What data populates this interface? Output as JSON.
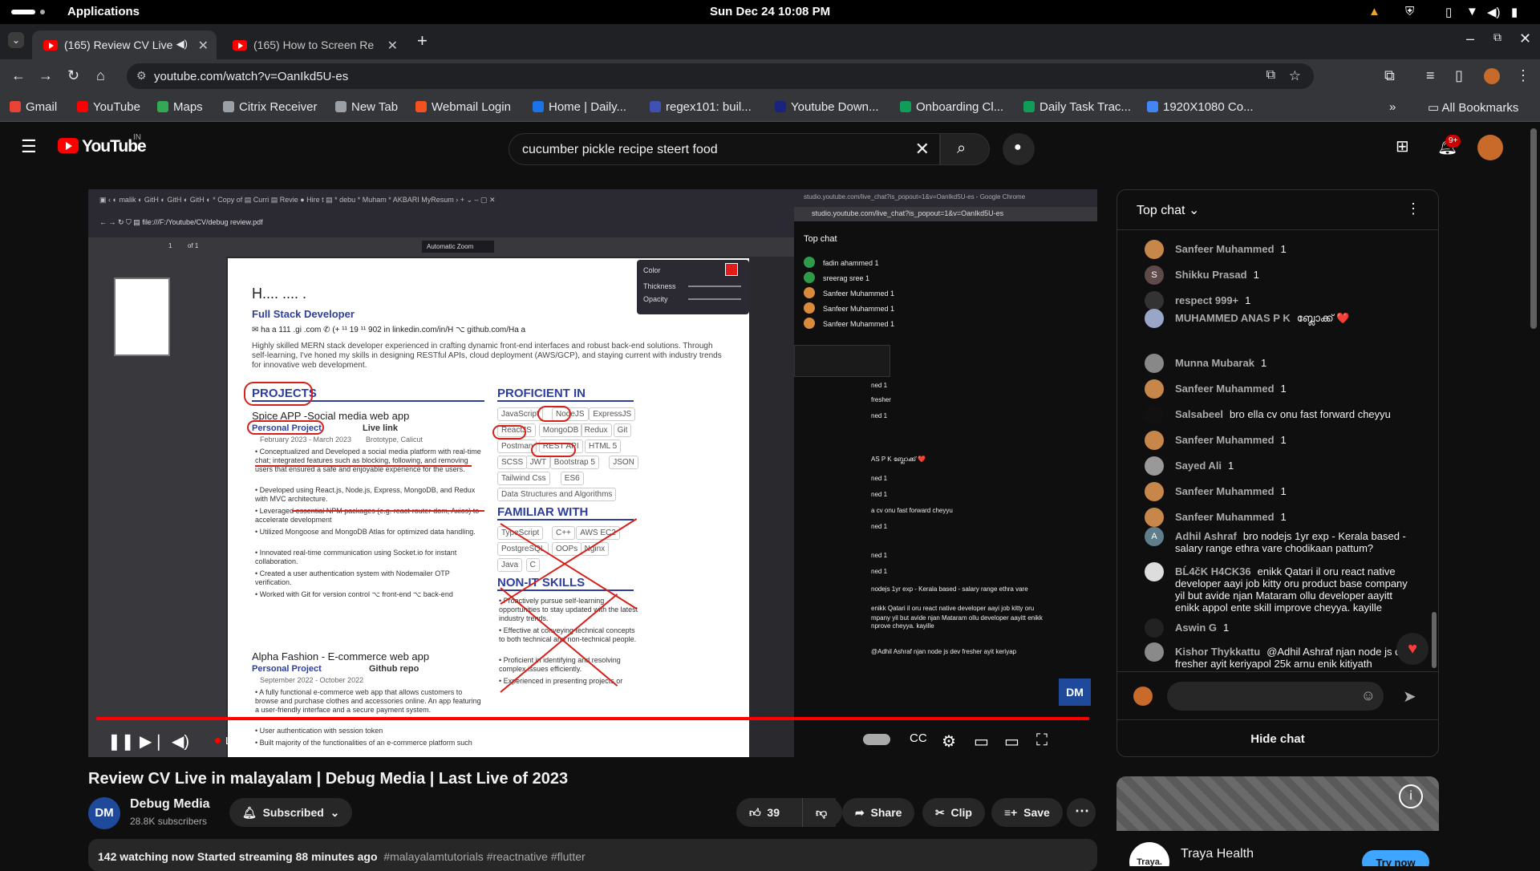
{
  "os": {
    "apps_label": "Applications",
    "clock": "Sun Dec 24  10:08 PM"
  },
  "tabs": [
    {
      "title": "(165) Review CV Live",
      "active": true
    },
    {
      "title": "(165) How to Screen Re",
      "active": false
    }
  ],
  "address": {
    "url": "youtube.com/watch?v=OanIkd5U-es"
  },
  "bookmarks": [
    {
      "label": "Gmail",
      "color": "#ea4335"
    },
    {
      "label": "YouTube",
      "color": "#ff0000"
    },
    {
      "label": "Maps",
      "color": "#34a853"
    },
    {
      "label": "Citrix Receiver",
      "color": "#9aa0a6"
    },
    {
      "label": "New Tab",
      "color": "#9aa0a6"
    },
    {
      "label": "Webmail Login",
      "color": "#f4511e"
    },
    {
      "label": "Home | Daily...",
      "color": "#1a73e8"
    },
    {
      "label": "regex101: buil...",
      "color": "#3f51b5"
    },
    {
      "label": "Youtube Down...",
      "color": "#1a237e"
    },
    {
      "label": "Onboarding Cl...",
      "color": "#0f9d58"
    },
    {
      "label": "Daily Task Trac...",
      "color": "#0f9d58"
    },
    {
      "label": "1920X1080 Co...",
      "color": "#4285f4"
    }
  ],
  "all_bookmarks_label": "All Bookmarks",
  "yt": {
    "wordmark": "YouTube",
    "country": "IN",
    "search_query": "cucumber pickle recipe steert food",
    "notifications": "9+"
  },
  "video": {
    "pdf": {
      "name": "Full Stack Developer",
      "contact": "✉ ha        a   111  .gi   .com        ✆ (+  ¹¹  19  ¹¹  902        in linkedin.com/in/H        ⌥ github.com/Ha        a",
      "summary": "Highly skilled MERN stack developer experienced in crafting dynamic front-end interfaces and robust back-end solutions. Through self-learning, I've honed my skills in designing RESTful APIs, cloud deployment (AWS/GCP), and staying current with industry trends for innovative web development.",
      "projects_h": "PROJECTS",
      "proj1_title": "Spice APP -Social media web app",
      "proj1_tag": "Personal Project",
      "proj1_link": "Live link",
      "proj1_date": "February 2023 - March 2023",
      "proj1_loc": "Brototype, Calicut",
      "proj1_bullets": [
        "• Conceptualized and Developed a social media platform with real-time chat; integrated features such as blocking, following, and removing users that ensured a safe and enjoyable experience for the users.",
        "• Developed using React.js, Node.js, Express, MongoDB, and Redux with MVC architecture.",
        "• Leveraged essential NPM packages (e.g. react-router-dom, Axios) to accelerate development",
        "• Utilized Mongoose and MongoDB Atlas for optimized data handling.",
        "• Innovated real-time communication using Socket.io for instant collaboration.",
        "• Created a user authentication system with Nodemailer OTP verification.",
        "• Worked with Git for version control  ⌥ front-end  ⌥ back-end"
      ],
      "proj2_title": "Alpha Fashion - E-commerce web app",
      "proj2_tag": "Personal Project",
      "proj2_link": "Github repo",
      "proj2_date": "September 2022 - October 2022",
      "proj2_bullets": [
        "• A fully functional e-commerce web app that allows customers to browse and purchase clothes and accessories online. An app featuring a user-friendly interface and a secure payment system.",
        "• User authentication with session token",
        "• Built majority of the functionalities of an e-commerce platform such"
      ],
      "proficient_h": "PROFICIENT IN",
      "proficient": [
        "JavaScript",
        "NodeJS",
        "ExpressJS",
        "ReactJS",
        "MongoDB",
        "Redux",
        "Git",
        "Postman",
        "REST API",
        "HTML 5",
        "SCSS",
        "JWT",
        "Bootstrap 5",
        "JSON",
        "Tailwind Css",
        "ES6",
        "Data Structures and Algorithms"
      ],
      "familiar_h": "FAMILIAR WITH",
      "familiar": [
        "TypeScript",
        "C++",
        "AWS EC2",
        "PostgreSQL",
        "OOPs",
        "Nginx",
        "Java",
        "C"
      ],
      "nonit_h": "NON-IT SKILLS",
      "nonit": [
        "• Proactively pursue self-learning opportunities to stay updated with the latest industry trends.",
        "• Effective at conveying technical concepts to both technical and non-technical people.",
        "• Proficient in identifying and resolving complex issues efficiently.",
        "• Experienced in presenting projects or"
      ],
      "path": "file:///F:/Youtube/CV/debug review.pdf",
      "page_of": "of 1",
      "page_num": "1",
      "zoom": "Automatic Zoom",
      "panel": {
        "color": "Color",
        "thickness": "Thickness",
        "opacity": "Opacity"
      }
    },
    "inner_chat": {
      "title": "studio.youtube.com/live_chat?is_popout=1&v=OanIkd5U-es - Google Chrome",
      "url": "studio.youtube.com/live_chat?is_popout=1&v=OanIkd5U-es",
      "header": "Top chat",
      "messages": [
        "fadin ahammed  1",
        "sreerag sree  1",
        "Sanfeer Muhammed  1",
        "Sanfeer Muhammed  1",
        "Sanfeer Muhammed  1"
      ],
      "fragments": [
        "ned 1",
        "fresher",
        "ned 1",
        "AS P K  ബ്ലോക്ക് ❤️",
        "ned 1",
        "ned 1",
        "a cv onu fast forward cheyyu",
        "ned 1",
        "ned 1",
        "ned 1",
        "nodejs 1yr exp - Kerala based - salary range ethra vare",
        "enikk Qatari il oru react native developer aayi job kitty oru",
        "mpany yil but avide njan Mataram ollu developer aayitt enikk",
        "nprove cheyya. kayille",
        "@Adhil Ashraf njan node js dev fresher ayit keriyap"
      ]
    },
    "live_label": "LIVE"
  },
  "chat": {
    "header": "Top chat",
    "messages": [
      {
        "author": "Sanfeer Muhammed",
        "text": "1",
        "avatar": "",
        "color": "#c8874a"
      },
      {
        "author": "Shikku Prasad",
        "text": "1",
        "avatar": "S",
        "color": "#5f4a4a"
      },
      {
        "author": "respect 999+",
        "text": "1",
        "avatar": "",
        "color": "#333333"
      },
      {
        "author": "MUHAMMED ANAS P K",
        "text": "ബ്ലോക്ക് ❤️",
        "avatar": "",
        "color": "#9aa6c8"
      },
      {
        "author": "Munna Mubarak",
        "text": "1",
        "avatar": "",
        "color": "#888888"
      },
      {
        "author": "Sanfeer Muhammed",
        "text": "1",
        "avatar": "",
        "color": "#c8874a"
      },
      {
        "author": "Salsabeel",
        "text": "bro ella cv onu fast forward cheyyu",
        "avatar": "",
        "color": "#111111"
      },
      {
        "author": "Sanfeer Muhammed",
        "text": "1",
        "avatar": "",
        "color": "#c8874a"
      },
      {
        "author": "Sayed Ali",
        "text": "1",
        "avatar": "",
        "color": "#999999"
      },
      {
        "author": "Sanfeer Muhammed",
        "text": "1",
        "avatar": "",
        "color": "#c8874a"
      },
      {
        "author": "Sanfeer Muhammed",
        "text": "1",
        "avatar": "",
        "color": "#c8874a"
      },
      {
        "author": "Adhil Ashraf",
        "text": "bro nodejs 1yr exp - Kerala based - salary range ethra vare chodikaan pattum?",
        "avatar": "A",
        "color": "#607d8b"
      },
      {
        "author": "BĹ4čK H4CK36",
        "text": "enikk Qatari il oru react native developer aayi job kitty oru product base company yil but avide njan Mataram ollu developer aayitt enikk appol ente skill improve cheyya. kayille",
        "avatar": "",
        "color": "#dddddd"
      },
      {
        "author": "Aswin G",
        "text": "1",
        "avatar": "",
        "color": "#222222"
      },
      {
        "author": "Kishor Thykkattu",
        "text": "@Adhil Ashraf njan node js dev fresher ayit keriyapol 25k arnu enik kitiyath",
        "avatar": "",
        "color": "#8a8a8a"
      }
    ],
    "hide_label": "Hide chat"
  },
  "meta": {
    "title": "Review CV Live in malayalam | Debug Media | Last Live of 2023",
    "channel": "Debug Media",
    "channel_avatar": "DM",
    "subscribers": "28.8K subscribers",
    "subscribed_label": "Subscribed",
    "likes": "39",
    "share_label": "Share",
    "clip_label": "Clip",
    "save_label": "Save",
    "desc_main": "142 watching now  Started streaming 88 minutes ago",
    "desc_tags": "#malayalamtutorials #reactnative #flutter"
  },
  "ad": {
    "logo": "Traya.",
    "name": "Traya Health",
    "cta": "Try now"
  }
}
